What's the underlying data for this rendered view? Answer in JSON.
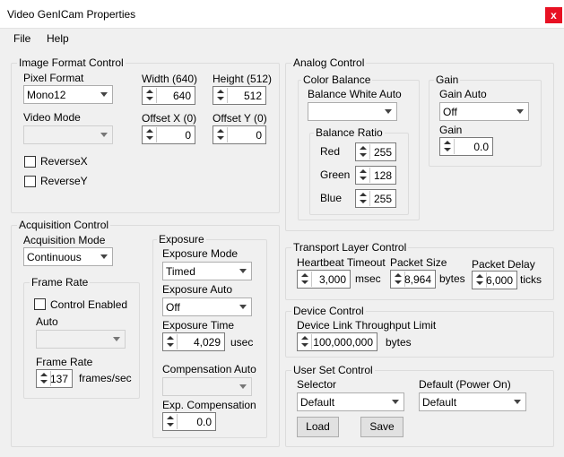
{
  "window": {
    "title": "Video GenICam Properties",
    "close_glyph": "x"
  },
  "menu": {
    "file": "File",
    "help": "Help"
  },
  "image_format": {
    "title": "Image Format Control",
    "pixel_format_label": "Pixel Format",
    "pixel_format_value": "Mono12",
    "video_mode_label": "Video Mode",
    "video_mode_value": "",
    "width_label": "Width (640)",
    "width_value": "640",
    "height_label": "Height (512)",
    "height_value": "512",
    "offset_x_label": "Offset X (0)",
    "offset_x_value": "0",
    "offset_y_label": "Offset Y (0)",
    "offset_y_value": "0",
    "reverse_x_label": "ReverseX",
    "reverse_y_label": "ReverseY"
  },
  "acquisition": {
    "title": "Acquisition Control",
    "mode_label": "Acquisition Mode",
    "mode_value": "Continuous",
    "frame_rate_group": "Frame Rate",
    "control_enabled_label": "Control Enabled",
    "auto_label": "Auto",
    "auto_value": "",
    "frame_rate_label": "Frame Rate",
    "frame_rate_value": "137",
    "frame_rate_unit": "frames/sec",
    "exposure_group": "Exposure",
    "exposure_mode_label": "Exposure Mode",
    "exposure_mode_value": "Timed",
    "exposure_auto_label": "Exposure Auto",
    "exposure_auto_value": "Off",
    "exposure_time_label": "Exposure Time",
    "exposure_time_value": "4,029",
    "exposure_time_unit": "usec",
    "compensation_auto_label": "Compensation Auto",
    "compensation_auto_value": "",
    "exp_compensation_label": "Exp. Compensation",
    "exp_compensation_value": "0.0"
  },
  "analog": {
    "title": "Analog Control",
    "color_balance_group": "Color Balance",
    "balance_white_auto_label": "Balance White Auto",
    "balance_white_auto_value": "",
    "balance_ratio_group": "Balance Ratio",
    "red_label": "Red",
    "red_value": "255",
    "green_label": "Green",
    "green_value": "128",
    "blue_label": "Blue",
    "blue_value": "255",
    "gain_group": "Gain",
    "gain_auto_label": "Gain Auto",
    "gain_auto_value": "Off",
    "gain_label": "Gain",
    "gain_value": "0.0"
  },
  "transport": {
    "title": "Transport Layer Control",
    "heartbeat_label": "Heartbeat Timeout",
    "heartbeat_value": "3,000",
    "heartbeat_unit": "msec",
    "packet_size_label": "Packet Size",
    "packet_size_value": "8,964",
    "packet_size_unit": "bytes",
    "packet_delay_label": "Packet Delay",
    "packet_delay_value": "6,000",
    "packet_delay_unit": "ticks"
  },
  "device": {
    "title": "Device Control",
    "throughput_label": "Device Link Throughput Limit",
    "throughput_value": "100,000,000",
    "throughput_unit": "bytes"
  },
  "user_set": {
    "title": "User Set Control",
    "selector_label": "Selector",
    "selector_value": "Default",
    "default_power_on_label": "Default (Power On)",
    "default_power_on_value": "Default",
    "load_label": "Load",
    "save_label": "Save"
  }
}
